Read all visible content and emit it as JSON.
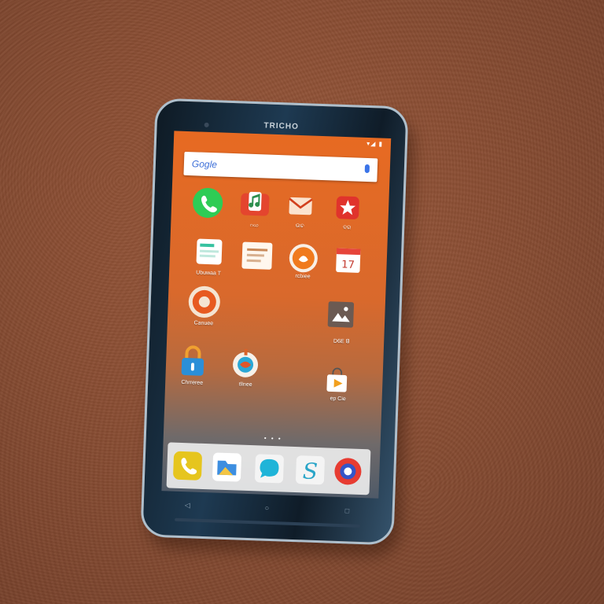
{
  "device": {
    "brand_text": "TRICHO",
    "status_text": "▾◢ ▮",
    "search_text": "Gogle",
    "nav": {
      "back": "◁",
      "home": "○",
      "recent": "□"
    },
    "page_dots": "• • •"
  },
  "colors": {
    "wallpaper_top": "#e76a22",
    "wallpaper_bottom": "#4f5a68",
    "leather": "#8a4e33",
    "phone_body": "#1e3a52"
  },
  "home_icons": [
    {
      "name": "phone-app",
      "icon": "phone-icon",
      "label": ""
    },
    {
      "name": "music-app",
      "icon": "music-icon",
      "label": "ဂဃ"
    },
    {
      "name": "mail-app",
      "icon": "envelope-icon",
      "label": "ଉଚ"
    },
    {
      "name": "red-app",
      "icon": "badge-icon",
      "label": "ବର"
    },
    {
      "name": "notes-app",
      "icon": "notes-icon",
      "label": "Ubuwaa T"
    },
    {
      "name": "doc-app",
      "icon": "document-icon",
      "label": ""
    },
    {
      "name": "orange-app",
      "icon": "orange-circle-icon",
      "label": "rcbiee"
    },
    {
      "name": "calendar-app",
      "icon": "calendar-icon",
      "label": ""
    },
    {
      "name": "ring-app",
      "icon": "ring-icon",
      "label": "Canuee"
    },
    {
      "name": "photo-app",
      "icon": "photo-icon",
      "label": "D6E ꓭ"
    },
    {
      "name": "lock-app",
      "icon": "padlock-icon",
      "label": "Chrreree"
    },
    {
      "name": "globe-app",
      "icon": "globe-icon",
      "label": "tllnee"
    },
    {
      "name": "bag-app",
      "icon": "shopping-bag-icon",
      "label": "ep Cie"
    }
  ],
  "dock_icons": [
    {
      "name": "dock-phone",
      "icon": "phone-icon"
    },
    {
      "name": "dock-files",
      "icon": "folder-icon"
    },
    {
      "name": "dock-chat",
      "icon": "chat-bubble-icon"
    },
    {
      "name": "dock-s",
      "icon": "s-icon"
    },
    {
      "name": "dock-browser",
      "icon": "browser-icon"
    }
  ]
}
